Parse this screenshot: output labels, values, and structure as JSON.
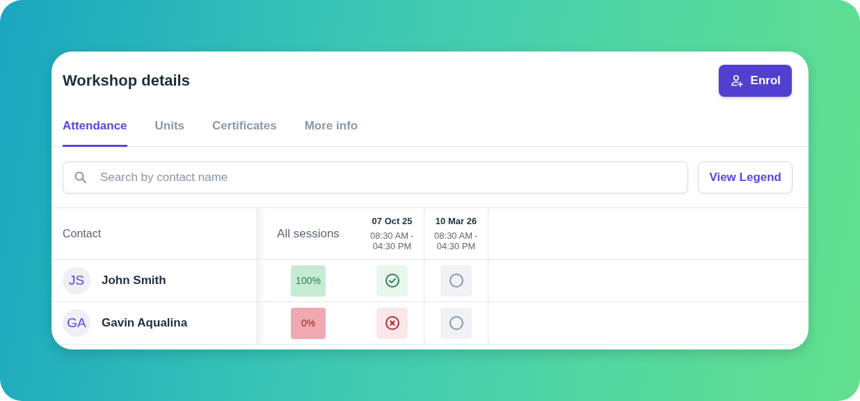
{
  "title": "Workshop details",
  "enrol_button": "Enrol",
  "tabs": [
    {
      "label": "Attendance",
      "selected": true
    },
    {
      "label": "Units",
      "selected": false
    },
    {
      "label": "Certificates",
      "selected": false
    },
    {
      "label": "More info",
      "selected": false
    }
  ],
  "search": {
    "placeholder": "Search by contact name"
  },
  "legend_button": "View Legend",
  "table": {
    "contact_heading": "Contact",
    "all_heading": "All sessions",
    "sessions": [
      {
        "date": "07 Oct 25",
        "time": "08:30 AM - 04:30 PM"
      },
      {
        "date": "10 Mar 26",
        "time": "08:30 AM - 04:30 PM"
      }
    ],
    "rows": [
      {
        "initials": "JS",
        "name": "John Smith",
        "percent": "100%",
        "kind": "good",
        "marks": [
          {
            "kind": "attended"
          },
          {
            "kind": "pending"
          }
        ]
      },
      {
        "initials": "GA",
        "name": "Gavin Aqualina",
        "percent": "0%",
        "kind": "bad",
        "marks": [
          {
            "kind": "absent"
          },
          {
            "kind": "pending"
          }
        ]
      }
    ]
  }
}
